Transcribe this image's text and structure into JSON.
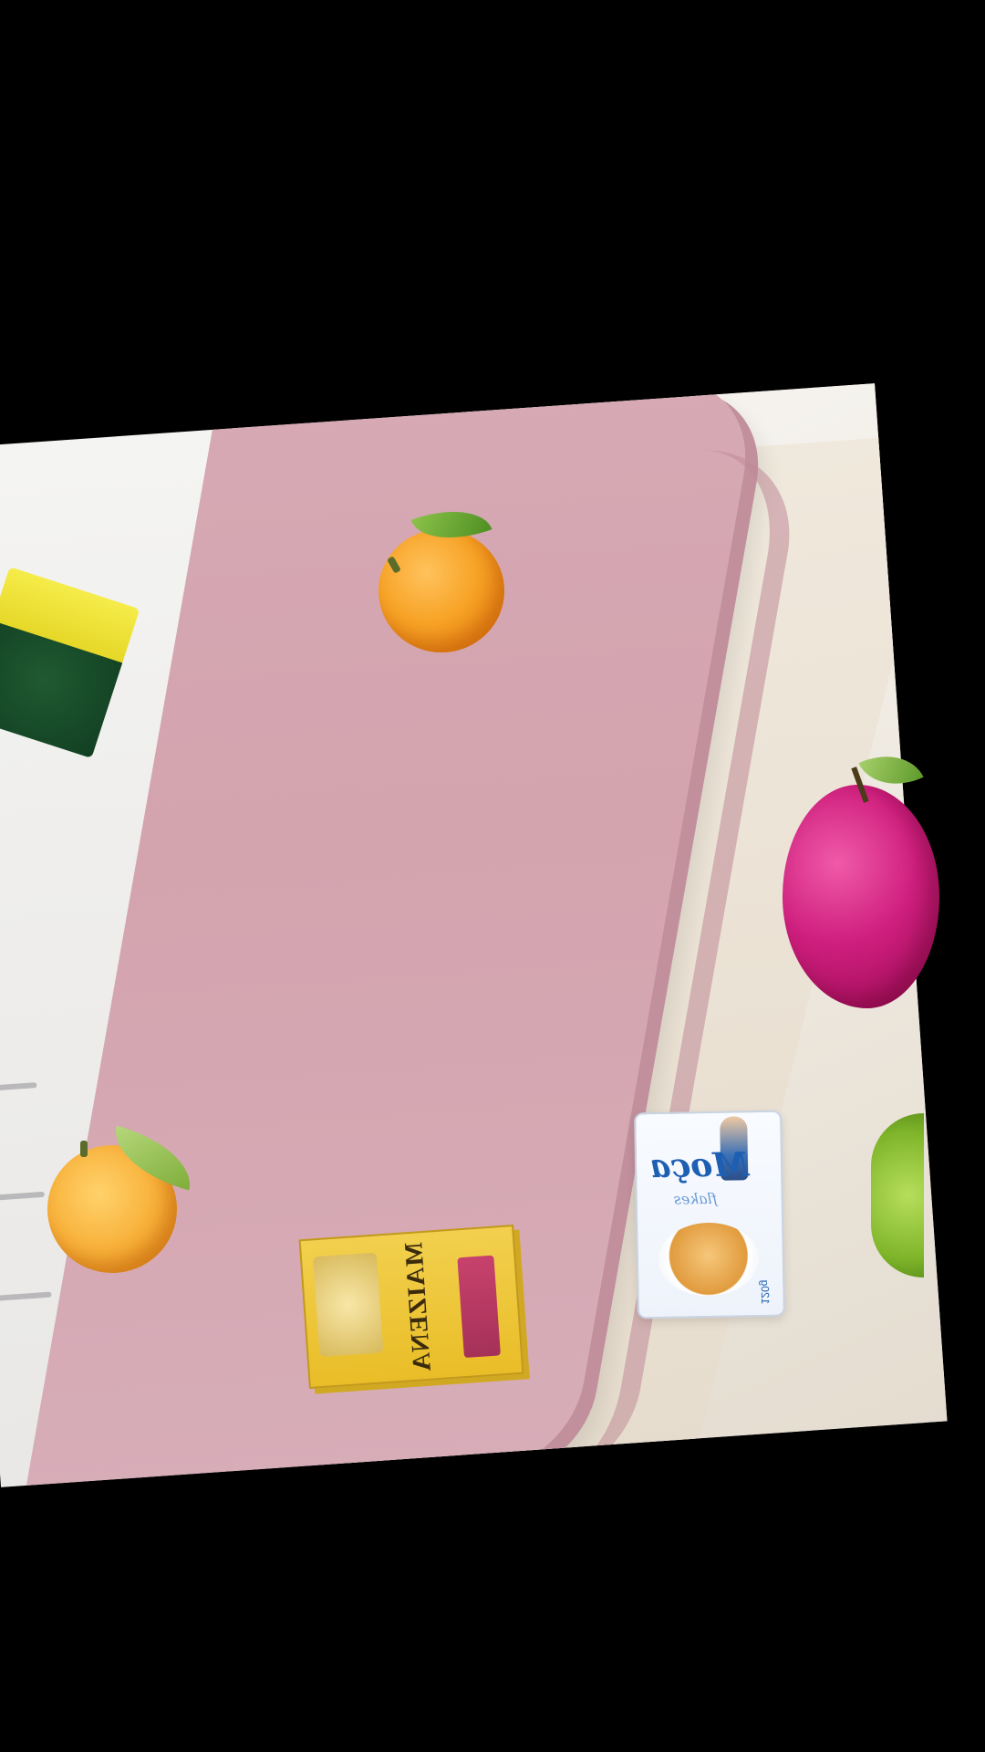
{
  "scene": {
    "background_color": "#000000",
    "description_colors": {
      "stool_top": "#d6a9b4",
      "floor": "#f4f4f2"
    }
  },
  "stickers": {
    "box_brand": "MAIZENA",
    "pouch_brand": "Moça",
    "pouch_subtitle": "flakes",
    "pouch_weight": "120g"
  }
}
